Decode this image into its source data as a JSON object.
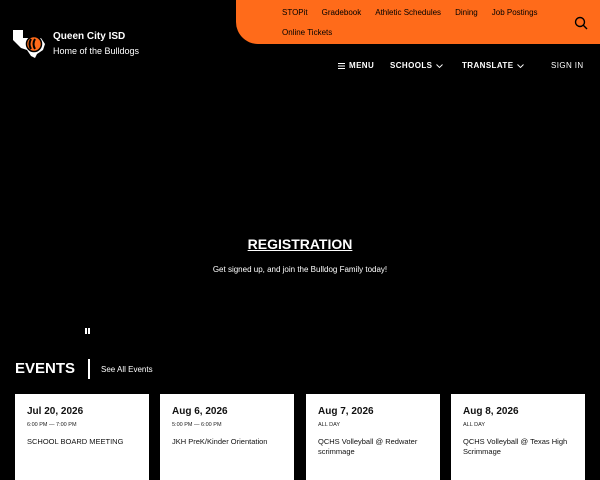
{
  "header": {
    "district_name": "Queen City ISD",
    "tagline": "Home of the Bulldogs",
    "quick_links": [
      "STOPit",
      "Gradebook",
      "Athletic Schedules",
      "Dining",
      "Job Postings",
      "Online Tickets"
    ],
    "nav": {
      "menu": "MENU",
      "schools": "SCHOOLS",
      "translate": "TRANSLATE",
      "sign_in": "SIGN IN"
    },
    "accent_color": "#ff6b1a"
  },
  "hero": {
    "title": "REGISTRATION",
    "subtitle": "Get signed up, and join the Bulldog Family today!"
  },
  "events": {
    "heading": "EVENTS",
    "see_all": "See All Events",
    "items": [
      {
        "date": "Jul 20, 2026",
        "time": "6:00 PM — 7:00 PM",
        "name": "SCHOOL BOARD MEETING"
      },
      {
        "date": "Aug 6, 2026",
        "time": "5:00 PM — 6:00 PM",
        "name": "JKH PreK/Kinder Orientation"
      },
      {
        "date": "Aug 7, 2026",
        "time": "ALL DAY",
        "name": "QCHS Volleyball @ Redwater scrimmage"
      },
      {
        "date": "Aug 8, 2026",
        "time": "ALL DAY",
        "name": "QCHS Volleyball @ Texas High Scrimmage"
      }
    ]
  }
}
